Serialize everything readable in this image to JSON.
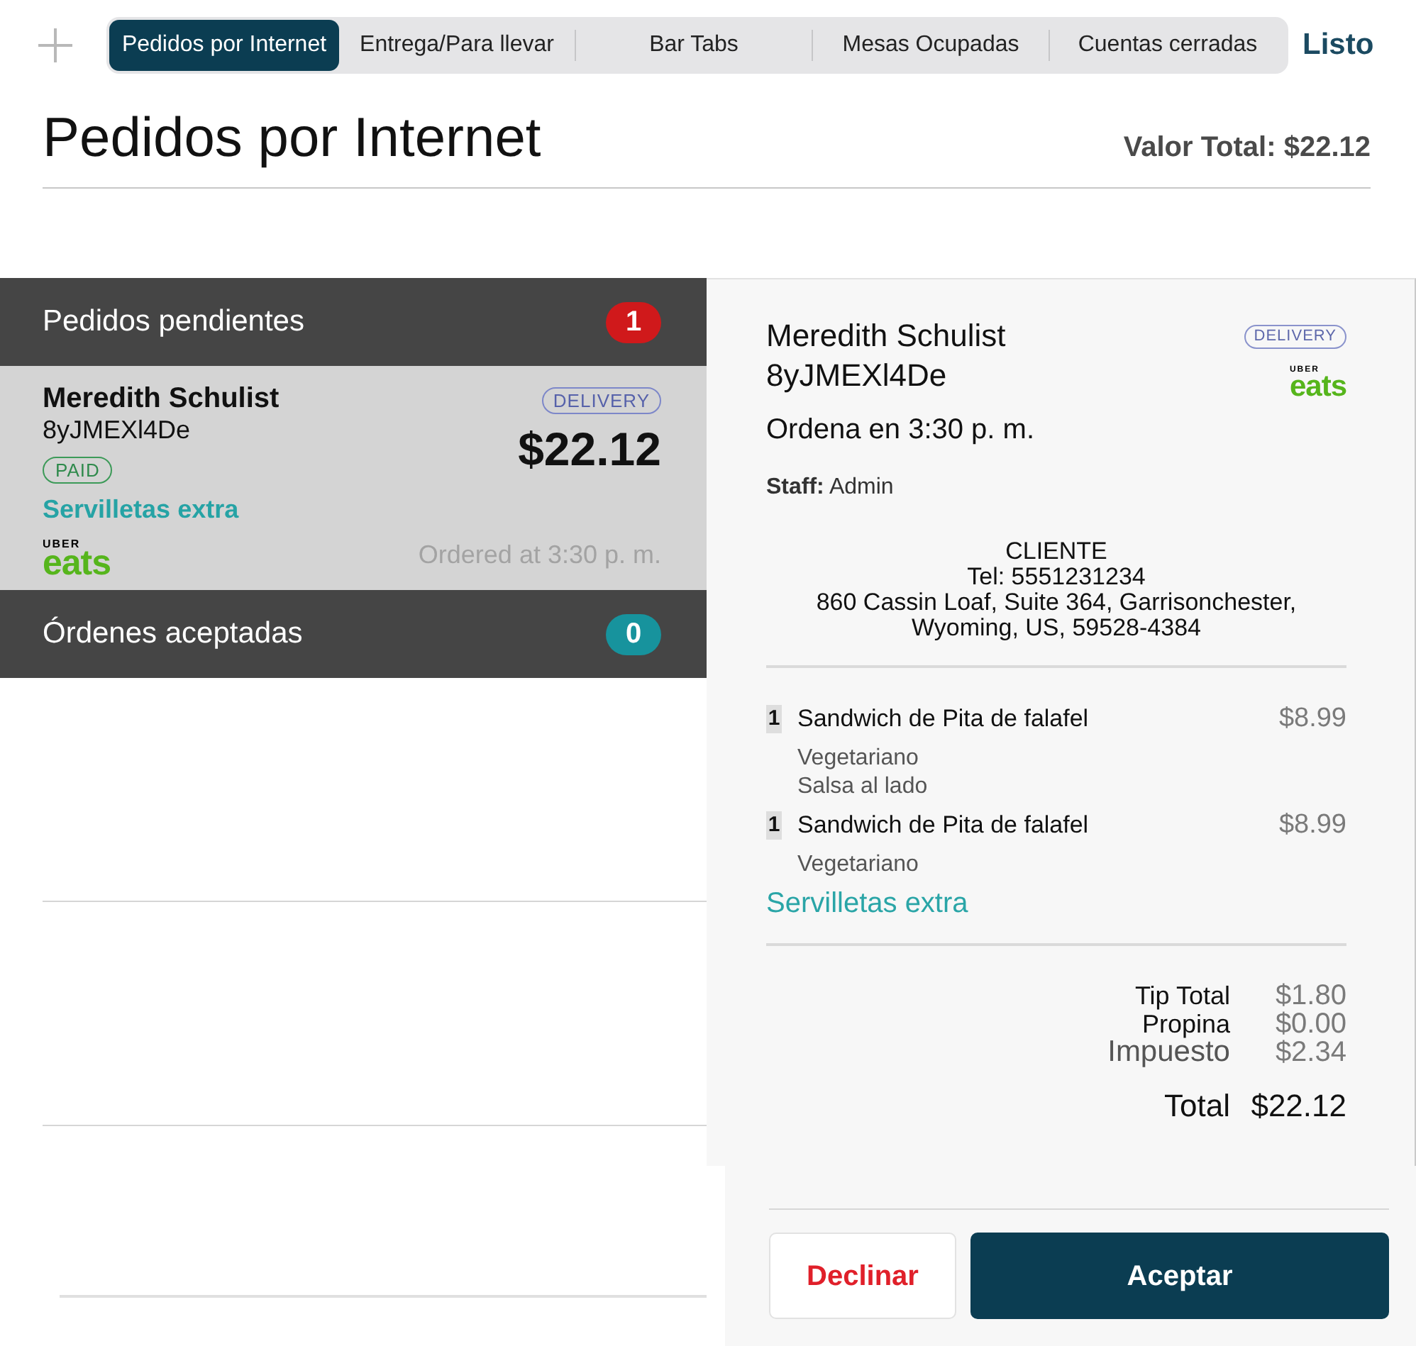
{
  "toolbar": {
    "tabs": [
      {
        "label": "Pedidos por Internet",
        "selected": true
      },
      {
        "label": "Entrega/Para llevar",
        "selected": false
      },
      {
        "label": "Bar Tabs",
        "selected": false
      },
      {
        "label": "Mesas Ocupadas",
        "selected": false
      },
      {
        "label": "Cuentas cerradas",
        "selected": false
      }
    ],
    "done_label": "Listo"
  },
  "page": {
    "title": "Pedidos por Internet",
    "total_value": "Valor Total: $22.12"
  },
  "order_list": {
    "sections": [
      {
        "title": "Pedidos pendientes",
        "count": "1",
        "color": "#d0191b",
        "orders": [
          {
            "name": "Meredith Schulist",
            "order_id": "8yJMEXl4De",
            "payment_status": "PAID",
            "note": "Servilletas extra",
            "logo": {
              "small": "UBER",
              "large": "eats"
            },
            "type": "DELIVERY",
            "total": "$22.12",
            "ordered_at": "Ordered at 3:30 p. m.",
            "selected": true
          }
        ]
      },
      {
        "title": "Órdenes aceptadas",
        "count": "0",
        "color": "#17939d"
      }
    ]
  },
  "detail": {
    "customer_name": "Meredith Schulist",
    "order_id": "8yJMEXl4De",
    "type": "DELIVERY",
    "logo": {
      "small": "UBER",
      "large": "eats"
    },
    "ordered_at": "Ordena en 3:30 p. m.",
    "staff": "**Staff:** Admin",
    "customer": {
      "heading": "CLIENTE",
      "phone": "Tel: 5551231234",
      "address": "860 Cassin Loaf, Suite 364, Garrisonchester, Wyoming, US, 59528-4384"
    },
    "items": [
      {
        "qty": "1",
        "name": "Sandwich de Pita de falafel",
        "price": "$8.99",
        "modifiers": [
          "Vegetariano",
          "Salsa al lado"
        ]
      },
      {
        "qty": "1",
        "name": "Sandwich de Pita de falafel",
        "price": "$8.99",
        "modifiers": [
          "Vegetariano"
        ]
      }
    ],
    "note": "Servilletas extra",
    "charges": [
      {
        "label": "Tip Total",
        "value": "$1.80",
        "kind": "tip"
      },
      {
        "label": "Propina",
        "value": "$0.00",
        "kind": "tip"
      },
      {
        "label": "Impuesto",
        "value": "$2.34",
        "kind": "tax"
      }
    ],
    "grand_total": {
      "label": "Total",
      "value": "$22.12"
    }
  },
  "actions": [
    {
      "label": "Declinar",
      "kind": "decline"
    },
    {
      "label": "Aceptar",
      "kind": "accept"
    }
  ]
}
